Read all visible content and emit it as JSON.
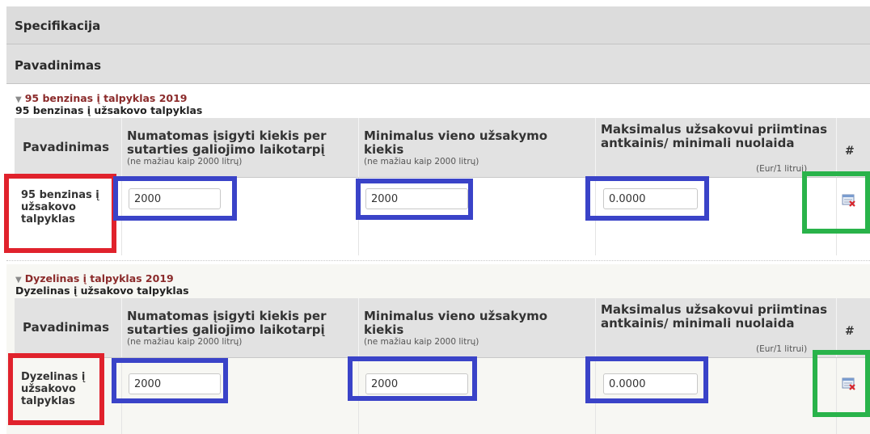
{
  "header": {
    "specification": "Specifikacija",
    "name": "Pavadinimas"
  },
  "columns": {
    "name": "Pavadinimas",
    "quantity": "Numatomas įsigyti kiekis per sutarties galiojimo laikotarpį",
    "quantity_note": "(ne mažiau kaip 2000 litrų)",
    "min_order": "Minimalus vieno užsakymo kiekis",
    "min_order_note": "(ne mažiau kaip 2000 litrų)",
    "max_markup": "Maksimalus užsakovui priimtinas antkainis/ minimali nuolaida",
    "max_markup_note": "(Eur/1 litrui)",
    "hash": "#"
  },
  "sections": [
    {
      "title": "95 benzinas į talpyklas 2019",
      "subtitle": "95 benzinas į užsakovo talpyklas",
      "row_label": "95 benzinas į užsakovo talpyklas",
      "quantity": "2000",
      "min_order": "2000",
      "max_markup": "0.0000",
      "delete_icon": "delete-row-icon"
    },
    {
      "title": "Dyzelinas į talpyklas 2019",
      "subtitle": "Dyzelinas į užsakovo talpyklas",
      "row_label": "Dyzelinas į užsakovo talpyklas",
      "quantity": "2000",
      "min_order": "2000",
      "max_markup": "0.0000",
      "delete_icon": "delete-row-icon"
    }
  ],
  "highlight_colors": {
    "label": "#e0222c",
    "input": "#3a43c8",
    "action": "#29b34a"
  }
}
